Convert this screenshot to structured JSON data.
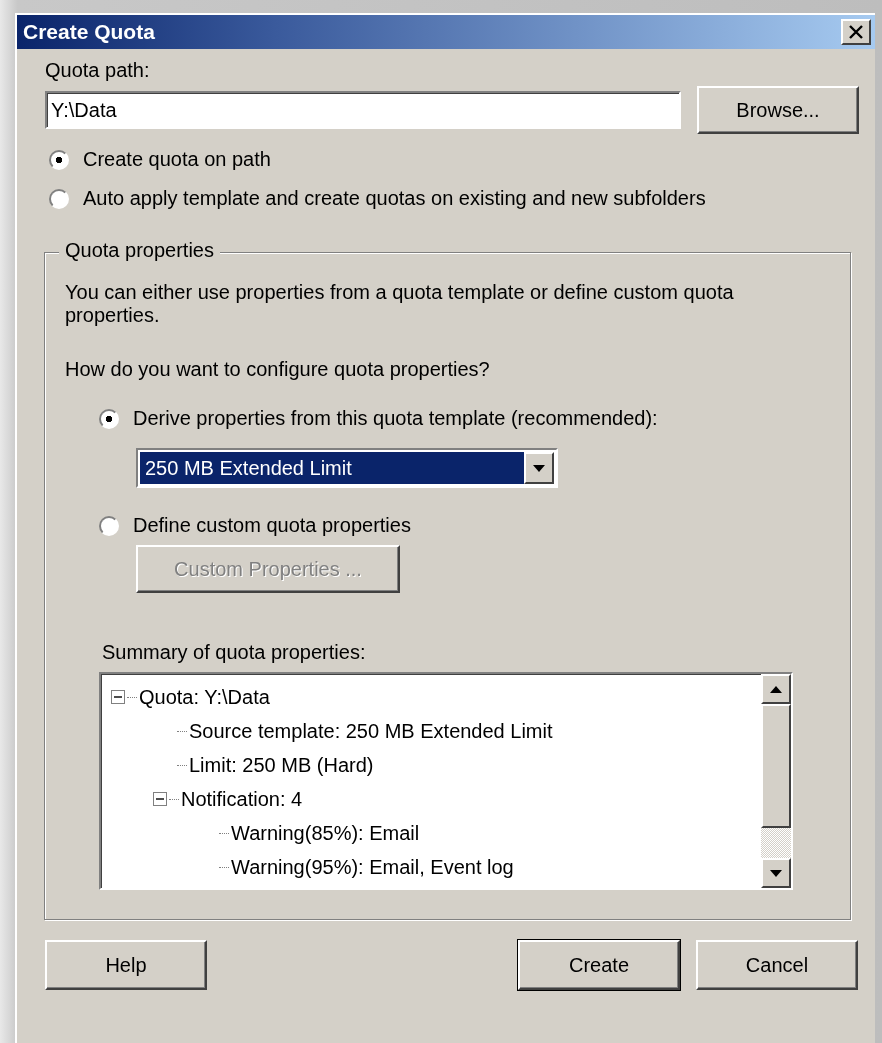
{
  "window": {
    "title": "Create Quota"
  },
  "quota_path": {
    "label": "Quota path:",
    "value": "Y:\\Data"
  },
  "browse_button": {
    "label": "Browse..."
  },
  "path_options": [
    {
      "label": "Create quota on path",
      "selected": true
    },
    {
      "label": "Auto apply template and create quotas on existing and new subfolders",
      "selected": false
    }
  ],
  "quota_properties": {
    "title": "Quota properties",
    "description": "You can either use properties from a quota template or define custom quota properties.",
    "question": "How do you want to configure quota properties?",
    "options": [
      {
        "kind": "template",
        "label": "Derive properties from this quota template (recommended):",
        "selected": true
      },
      {
        "kind": "custom",
        "label": "Define custom quota properties",
        "selected": false
      }
    ],
    "template_dropdown": {
      "value": "250 MB Extended Limit"
    },
    "custom_button": {
      "label": "Custom Properties ...",
      "disabled": true
    },
    "summary": {
      "label": "Summary of quota properties:",
      "tree": [
        {
          "label": "Quota: Y:\\Data",
          "expanded": true,
          "children": [
            {
              "label": "Source template: 250 MB Extended Limit"
            },
            {
              "label": "Limit: 250 MB (Hard)"
            },
            {
              "label": "Notification: 4",
              "expanded": true,
              "children": [
                {
                  "label": "Warning(85%): Email"
                },
                {
                  "label": "Warning(95%): Email, Event log"
                }
              ]
            }
          ]
        }
      ]
    }
  },
  "buttons": [
    {
      "label": "Help",
      "default": false
    },
    {
      "label": "Create",
      "default": true
    },
    {
      "label": "Cancel",
      "default": false
    }
  ]
}
